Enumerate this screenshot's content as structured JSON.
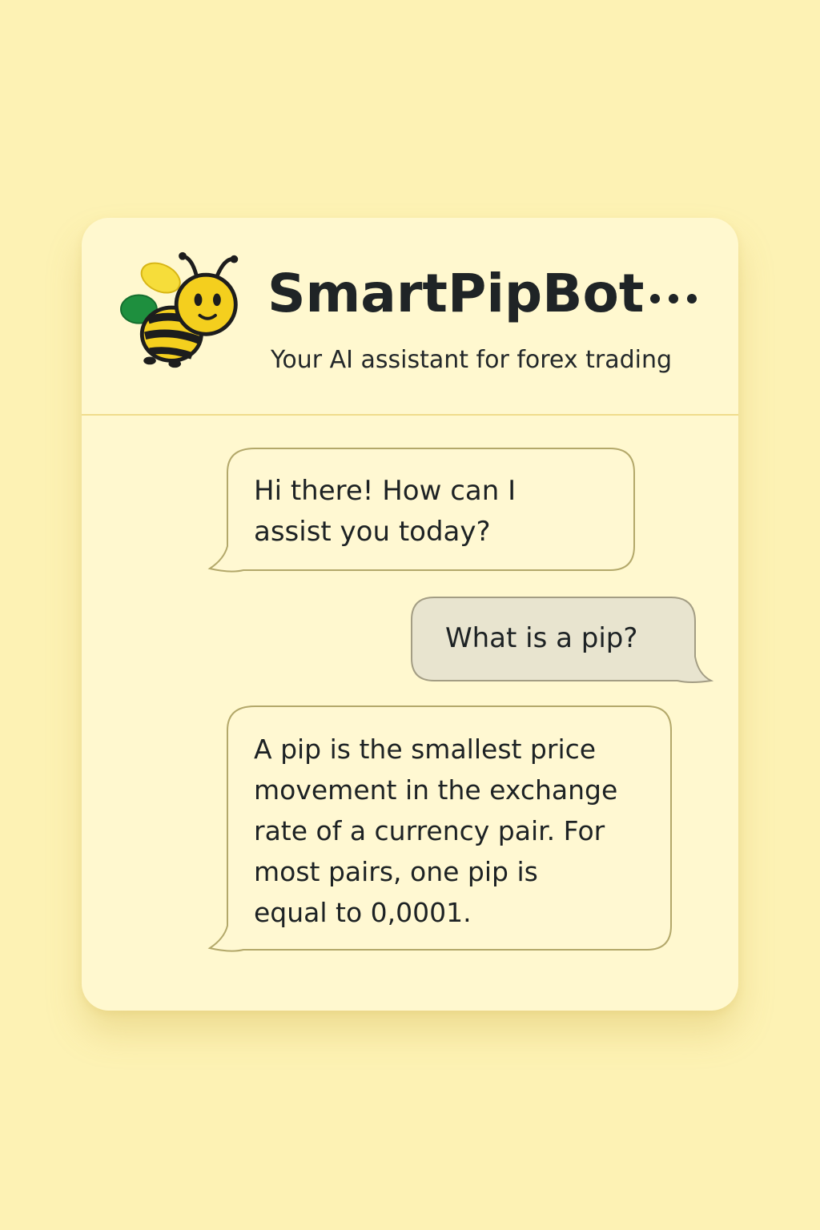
{
  "app": {
    "title": "SmartPipBot",
    "subtitle": "Your AI assistant for forex trading",
    "logo_icon": "bee-icon",
    "menu_icon": "more-dots-icon"
  },
  "messages": [
    {
      "sender": "bot",
      "text": "Hi there! How can I\nassist you today?"
    },
    {
      "sender": "user",
      "text": "What is a pip?"
    },
    {
      "sender": "bot",
      "text": "A pip is the smallest price\nmovement in the exchange\nrate of a currency pair. For\nmost pairs, one pip is\nequal to 0,0001."
    }
  ],
  "colors": {
    "background": "#fdf2b4",
    "card": "#fff8cf",
    "bot_bubble": "#fff8d2",
    "user_bubble": "#e8e4cf",
    "bubble_border": "#b3a86a",
    "bee_yellow": "#f4cf1e",
    "bee_wing_green": "#1e8f3e"
  }
}
